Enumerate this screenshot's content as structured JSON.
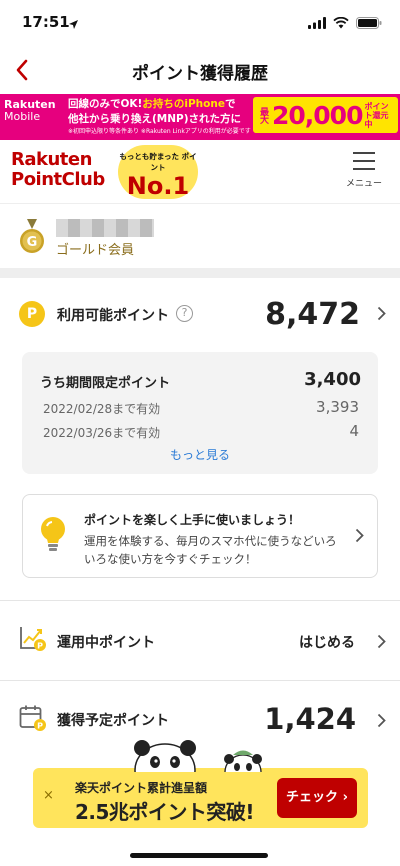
{
  "status_bar": {
    "time": "17:51"
  },
  "header": {
    "title": "ポイント獲得履歴"
  },
  "mobile_banner": {
    "brand_line1": "Rakuten",
    "brand_line2": "Mobile",
    "line1_a": "回線のみでOK!",
    "line1_b": "お持ちのiPhone",
    "line1_c": "で",
    "line2": "他社から乗り換え(MNP)された方に",
    "note": "※初回申込限り等条件あり ※Rakuten Linkアプリの利用が必要です",
    "max_label": "最大",
    "amount": "20,000",
    "suffix": "ポイント還元中"
  },
  "point_club": {
    "logo_line1": "Rakuten",
    "logo_line2": "PointClub",
    "badge_line1": "もっとも貯まった ポイント",
    "badge_line2": "No.1",
    "menu_label": "メニュー"
  },
  "member": {
    "medal_letter": "G",
    "rank": "ゴールド会員"
  },
  "available": {
    "coin": "P",
    "label": "利用可能ポイント",
    "help": "?",
    "value": "8,472"
  },
  "limited": {
    "title": "うち期間限定ポイント",
    "total": "3,400",
    "rows": [
      {
        "label": "2022/02/28まで有効",
        "value": "3,393"
      },
      {
        "label": "2022/03/26まで有効",
        "value": "4"
      }
    ],
    "more": "もっと見る"
  },
  "tip": {
    "title": "ポイントを楽しく上手に使いましょう！",
    "body": "運用を体験する、毎月のスマホ代に使うなどいろいろな使い方を今すぐチェック！"
  },
  "investment": {
    "label": "運用中ポイント",
    "action": "はじめる"
  },
  "scheduled": {
    "label": "獲得予定ポイント",
    "value": "1,424"
  },
  "campaign": {
    "close": "×",
    "line1": "楽天ポイント累計進呈額",
    "line2": "2.5兆ポイント突破!",
    "button": "チェック ›"
  },
  "colors": {
    "rakuten_red": "#bf0000",
    "gold": "#f5c518",
    "mobile_pink": "#e6007e",
    "banner_yellow": "#ffe45c",
    "link_blue": "#2b7bd6"
  }
}
